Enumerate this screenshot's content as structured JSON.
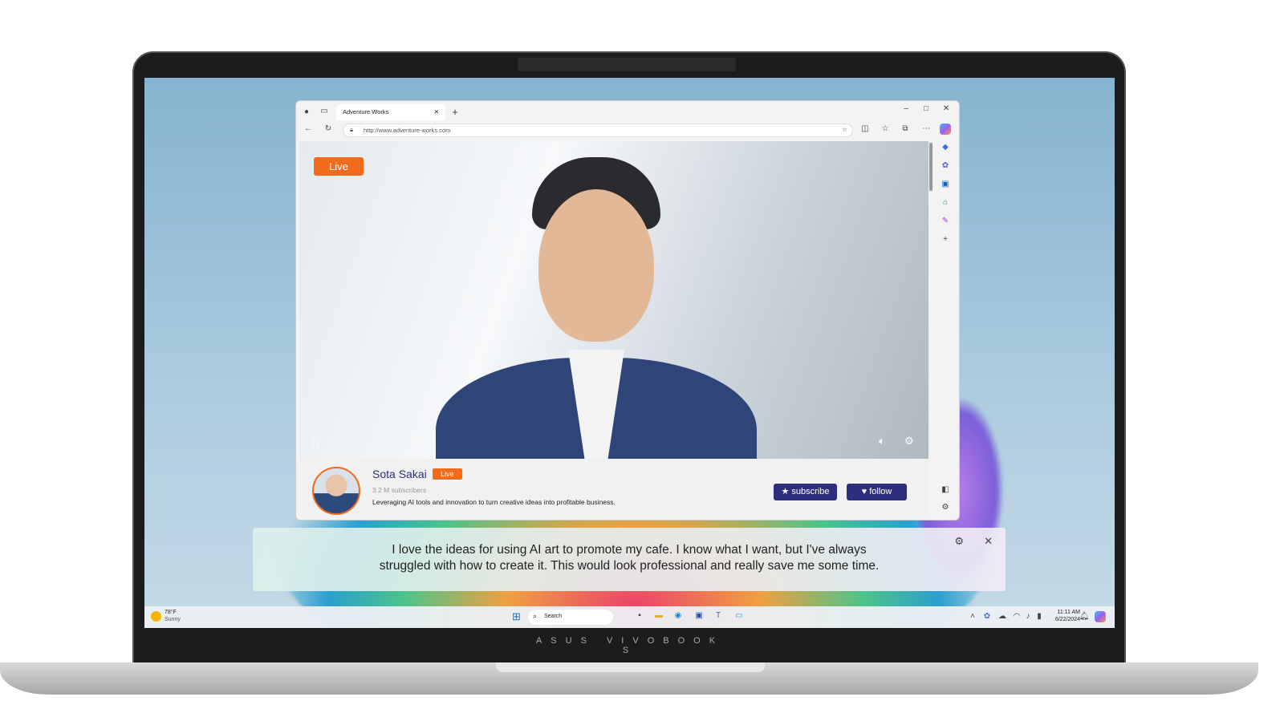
{
  "browser": {
    "tab_title": "Adventure Works",
    "url": "http://www.adventure-works.com"
  },
  "video": {
    "live_badge": "Live"
  },
  "channel": {
    "name": "Sota Sakai",
    "live_badge": "Live",
    "subscribers": "3.2 M subscribers",
    "description": "Leveraging AI tools and innovation to turn creative ideas into profitable business.",
    "subscribe_label": "subscribe",
    "follow_label": "follow"
  },
  "caption": {
    "line1": "I love the ideas for using AI art to promote my cafe. I know what I want, but I've always",
    "line2": "struggled with how to create it. This would look professional and really save me some time."
  },
  "taskbar": {
    "weather_temp": "78°F",
    "weather_desc": "Sunny",
    "search_placeholder": "Search",
    "time": "11:11 AM",
    "date": "6/22/2024"
  },
  "laptop": {
    "brand": "ASUS VIVOBOOK S"
  },
  "colors": {
    "accent": "#f26a1b",
    "button": "#2d2f7d"
  }
}
